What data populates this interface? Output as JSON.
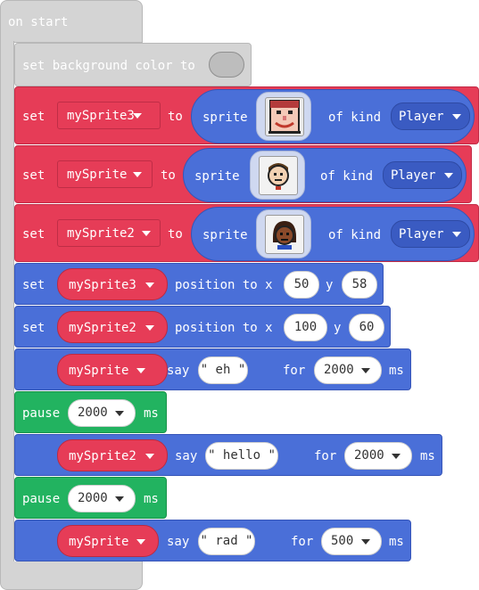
{
  "on_start": {
    "label": "on start"
  },
  "bg_block": {
    "label": "set background color to"
  },
  "assign_blocks": [
    {
      "set_label": "set",
      "variable": "mySprite3",
      "to_label": "to",
      "sprite_label": "sprite",
      "of_kind_label": "of kind",
      "kind": "Player",
      "sprite_icon": "smiling-face-sprite-icon"
    },
    {
      "set_label": "set",
      "variable": "mySprite",
      "to_label": "to",
      "sprite_label": "sprite",
      "of_kind_label": "of kind",
      "kind": "Player",
      "sprite_icon": "boy-face-sprite-icon"
    },
    {
      "set_label": "set",
      "variable": "mySprite2",
      "to_label": "to",
      "sprite_label": "sprite",
      "of_kind_label": "of kind",
      "kind": "Player",
      "sprite_icon": "girl-face-sprite-icon"
    }
  ],
  "position_blocks": [
    {
      "set_label": "set",
      "variable": "mySprite3",
      "position_label": "position to x",
      "x": "50",
      "y_label": "y",
      "y": "58"
    },
    {
      "set_label": "set",
      "variable": "mySprite2",
      "position_label": "position to x",
      "x": "100",
      "y_label": "y",
      "y": "60"
    }
  ],
  "say_blocks": [
    {
      "variable": "mySprite",
      "say_label": "say",
      "text": "\" eh \"",
      "for_label": "for",
      "duration": "2000",
      "ms_label": "ms"
    },
    {
      "variable": "mySprite2",
      "say_label": "say",
      "text": "\" hello \"",
      "for_label": "for",
      "duration": "2000",
      "ms_label": "ms"
    },
    {
      "variable": "mySprite",
      "say_label": "say",
      "text": "\" rad \"",
      "for_label": "for",
      "duration": "500",
      "ms_label": "ms"
    }
  ],
  "pause_blocks": [
    {
      "pause_label": "pause",
      "duration": "2000",
      "ms_label": "ms"
    },
    {
      "pause_label": "pause",
      "duration": "2000",
      "ms_label": "ms"
    }
  ],
  "colors": {
    "hat_grey": "#d4d4d4",
    "variables_red": "#e63c57",
    "sprites_blue": "#4a6fd8",
    "loops_green": "#22b360"
  }
}
